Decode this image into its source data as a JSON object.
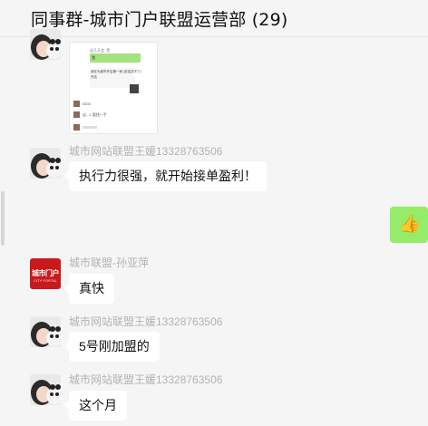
{
  "chat": {
    "title": "同事群-城市门户联盟运营部 (29)"
  },
  "image_message": {
    "lines": [
      "这几天会, 是",
      "我",
      "我在为超市开店第一家 (说话并不了)",
      "开店",
      "5003",
      "店 - 1 要找一手"
    ]
  },
  "messages": [
    {
      "sender": "城市网站联盟王媛13328763506",
      "text": "执行力很强，就开始接单盈利！"
    },
    {
      "sender": "城市联盟-孙亚萍",
      "text": "真快"
    },
    {
      "sender": "城市网站联盟王媛13328763506",
      "text": "5号刚加盟的"
    },
    {
      "sender": "城市网站联盟王媛13328763506",
      "text": "这个月"
    }
  ],
  "self_message": {
    "emoji": "👍"
  },
  "logo_avatar": {
    "text": "城市门户",
    "subtext": "CITY PORTAL"
  },
  "colors": {
    "background": "#f5f5f5",
    "self_bubble": "#95ec69",
    "logo": "#c8191c"
  }
}
